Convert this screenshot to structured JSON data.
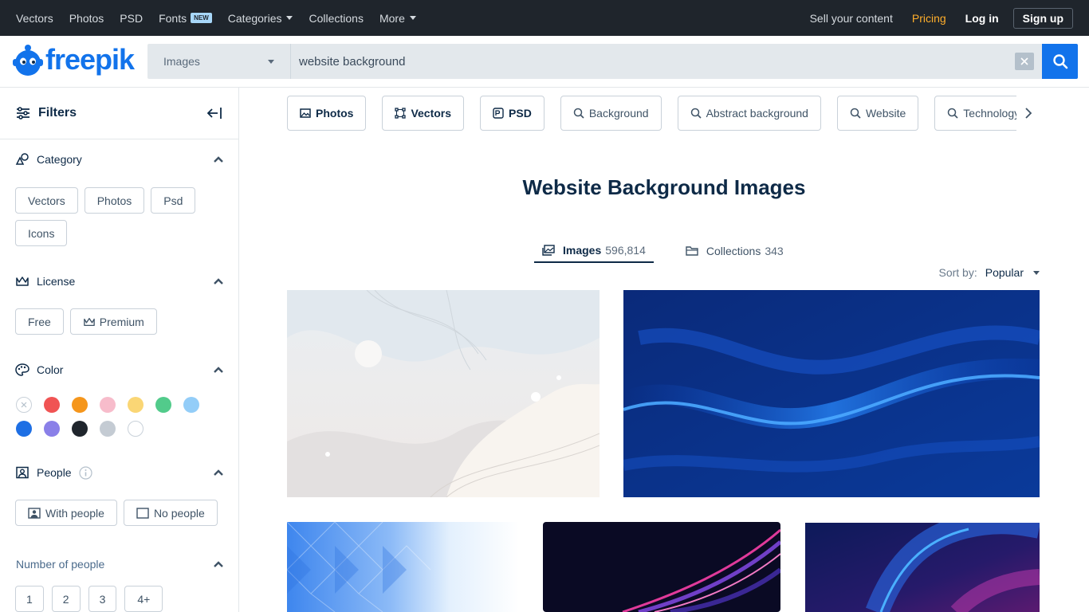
{
  "topnav": {
    "items": [
      {
        "label": "Vectors"
      },
      {
        "label": "Photos"
      },
      {
        "label": "PSD"
      },
      {
        "label": "Fonts",
        "badge": "NEW"
      },
      {
        "label": "Categories",
        "dropdown": true
      },
      {
        "label": "Collections"
      },
      {
        "label": "More",
        "dropdown": true
      }
    ],
    "sell": "Sell your content",
    "pricing": "Pricing",
    "login": "Log in",
    "signup": "Sign up"
  },
  "header": {
    "logo_text": "freepik",
    "search_type": "Images",
    "search_value": "website background",
    "clear_icon": "close-icon",
    "search_icon": "search-icon"
  },
  "sidebar": {
    "title": "Filters",
    "category": {
      "label": "Category",
      "options": [
        "Vectors",
        "Photos",
        "Psd",
        "Icons"
      ]
    },
    "license": {
      "label": "License",
      "free": "Free",
      "premium": "Premium"
    },
    "color": {
      "label": "Color",
      "swatches": [
        "#f05454",
        "#f5961c",
        "#f7bccb",
        "#fad675",
        "#52cb8b",
        "#93cdf8",
        "#1e6fe4",
        "#8a80e8",
        "#1f252c",
        "#c4cbd3",
        "#ffffff"
      ]
    },
    "people": {
      "label": "People",
      "with": "With people",
      "without": "No people"
    },
    "number_of_people": {
      "label": "Number of people",
      "options": [
        "1",
        "2",
        "3",
        "4+"
      ]
    }
  },
  "main": {
    "tags": [
      {
        "label": "Photos",
        "icon": "image-icon",
        "bold": true
      },
      {
        "label": "Vectors",
        "icon": "vector-icon",
        "bold": true
      },
      {
        "label": "PSD",
        "icon": "psd-icon",
        "bold": true
      },
      {
        "label": "Background",
        "icon": "search-icon"
      },
      {
        "label": "Abstract background",
        "icon": "search-icon"
      },
      {
        "label": "Website",
        "icon": "search-icon"
      },
      {
        "label": "Technology",
        "icon": "search-icon"
      }
    ],
    "title": "Website Background Images",
    "tabs": {
      "images_label": "Images",
      "images_count": "596,814",
      "collections_label": "Collections",
      "collections_count": "343"
    },
    "sort": {
      "label": "Sort by:",
      "value": "Popular"
    }
  }
}
